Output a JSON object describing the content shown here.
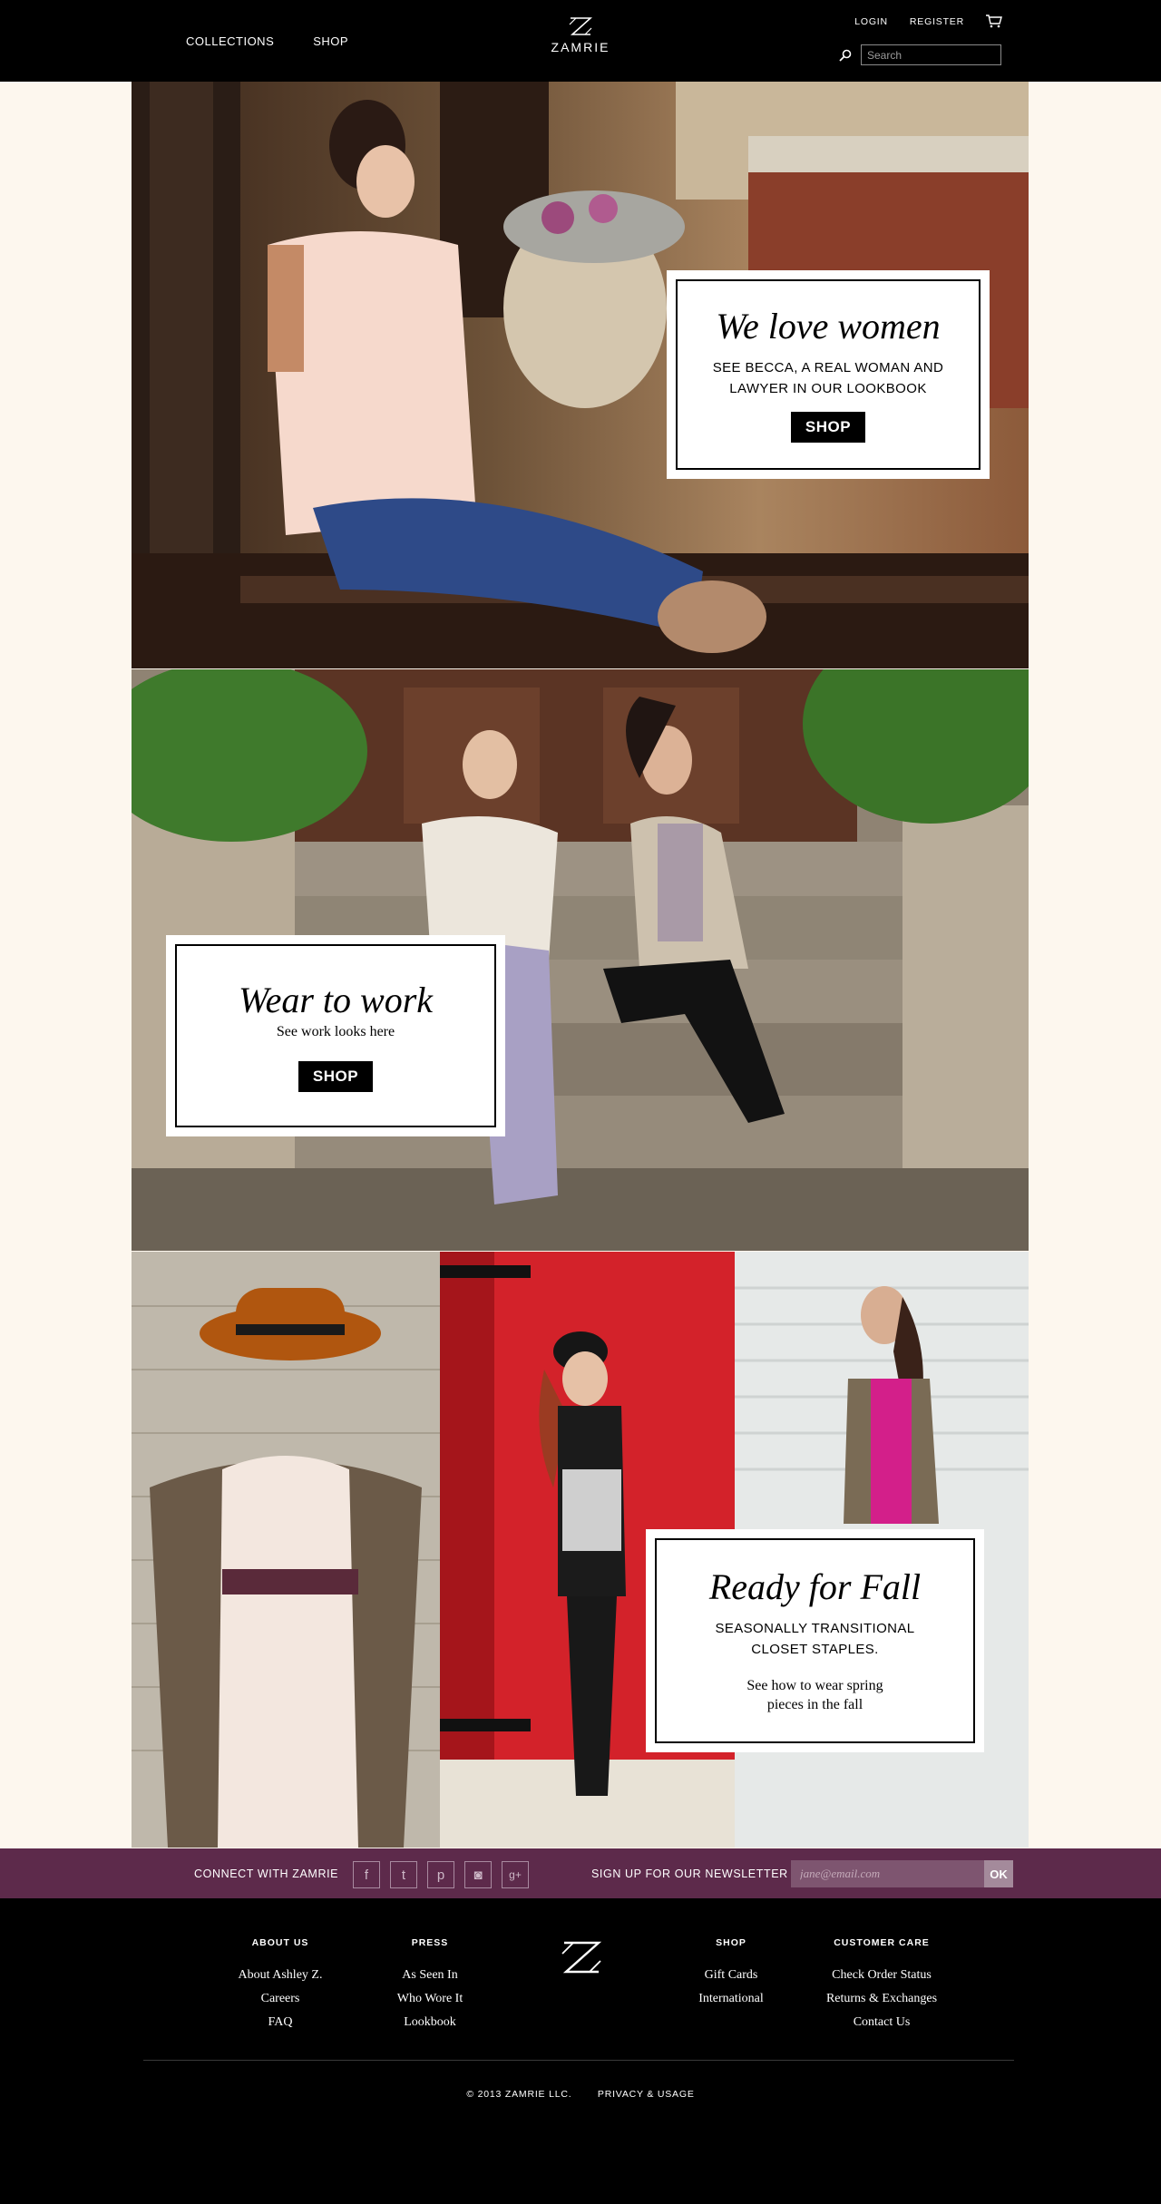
{
  "header": {
    "nav_left": [
      "COLLECTIONS",
      "SHOP"
    ],
    "logo_text": "ZAMRIE",
    "login": "LOGIN",
    "register": "REGISTER",
    "search_placeholder": "Search"
  },
  "promos": [
    {
      "headline": "We love women",
      "sub_line1": "SEE BECCA, A REAL WOMAN AND",
      "sub_line2": "LAWYER IN OUR LOOKBOOK",
      "button": "SHOP"
    },
    {
      "headline": "Wear to work",
      "sub": "See work looks here",
      "button": "SHOP"
    },
    {
      "headline": "Ready for Fall",
      "sub_line1": "SEASONALLY TRANSITIONAL",
      "sub_line2": "CLOSET STAPLES.",
      "note_line1": "See how to wear spring",
      "note_line2": "pieces in the fall"
    }
  ],
  "social": {
    "connect_label": "CONNECT WITH ZAMRIE",
    "icons": [
      "facebook-icon",
      "twitter-icon",
      "pinterest-icon",
      "instagram-icon",
      "google-plus-icon"
    ],
    "icon_glyphs": [
      "f",
      "t",
      "p",
      "◙",
      "g+"
    ],
    "newsletter_label": "SIGN UP FOR OUR NEWSLETTER",
    "newsletter_placeholder": "jane@email.com",
    "ok": "OK"
  },
  "footer": {
    "about": {
      "title": "ABOUT US",
      "links": [
        "About Ashley Z.",
        "Careers",
        "FAQ"
      ]
    },
    "press": {
      "title": "PRESS",
      "links": [
        "As Seen In",
        "Who Wore It",
        "Lookbook"
      ]
    },
    "shop": {
      "title": "SHOP",
      "links": [
        "Gift Cards",
        "International"
      ]
    },
    "care": {
      "title": "CUSTOMER CARE",
      "links": [
        "Check Order Status",
        "Returns & Exchanges",
        "Contact Us"
      ]
    },
    "copyright": "© 2013 ZAMRIE LLC.",
    "privacy": "PRIVACY & USAGE"
  },
  "colors": {
    "header_bg": "#000000",
    "page_bg": "#fdf7ee",
    "social_bar": "#5d2a4b",
    "footer_bg": "#000000"
  }
}
